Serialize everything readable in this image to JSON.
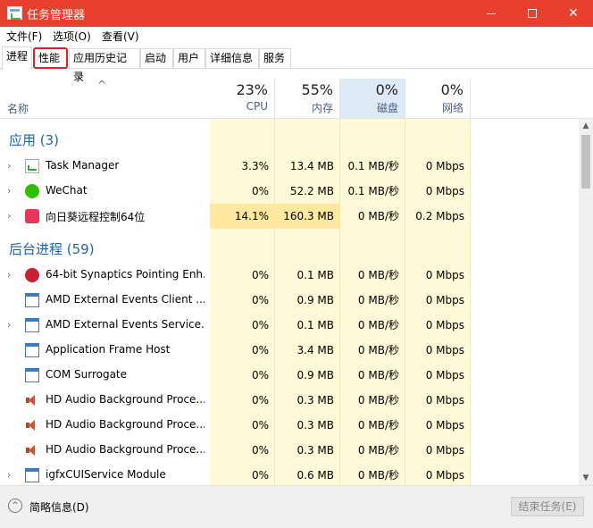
{
  "window": {
    "title": "任务管理器"
  },
  "menu": {
    "file": "文件(F)",
    "options": "选项(O)",
    "view": "查看(V)"
  },
  "tabs": [
    {
      "label": "进程"
    },
    {
      "label": "性能"
    },
    {
      "label": "应用历史记录"
    },
    {
      "label": "启动"
    },
    {
      "label": "用户"
    },
    {
      "label": "详细信息"
    },
    {
      "label": "服务"
    }
  ],
  "header": {
    "name_label": "名称",
    "cpu": {
      "pct": "23%",
      "label": "CPU"
    },
    "memory": {
      "pct": "55%",
      "label": "内存"
    },
    "disk": {
      "pct": "0%",
      "label": "磁盘"
    },
    "network": {
      "pct": "0%",
      "label": "网络"
    }
  },
  "groups": {
    "apps": "应用 (3)",
    "background": "后台进程 (59)"
  },
  "apps": [
    {
      "name": "Task Manager",
      "cpu": "3.3%",
      "mem": "13.4 MB",
      "disk": "0.1 MB/秒",
      "net": "0 Mbps",
      "icon": "task-manager-icon"
    },
    {
      "name": "WeChat",
      "cpu": "0%",
      "mem": "52.2 MB",
      "disk": "0.1 MB/秒",
      "net": "0 Mbps",
      "icon": "wechat-icon"
    },
    {
      "name": "向日葵远程控制64位",
      "cpu": "14.1%",
      "mem": "160.3 MB",
      "disk": "0 MB/秒",
      "net": "0.2 Mbps",
      "icon": "sunlogin-icon"
    }
  ],
  "background": [
    {
      "name": "64-bit Synaptics Pointing Enh...",
      "cpu": "0%",
      "mem": "0.1 MB",
      "disk": "0 MB/秒",
      "net": "0 Mbps",
      "icon": "synaptics-icon"
    },
    {
      "name": "AMD External Events Client ...",
      "cpu": "0%",
      "mem": "0.9 MB",
      "disk": "0 MB/秒",
      "net": "0 Mbps",
      "icon": "window-icon"
    },
    {
      "name": "AMD External Events Service...",
      "cpu": "0%",
      "mem": "0.1 MB",
      "disk": "0 MB/秒",
      "net": "0 Mbps",
      "icon": "window-icon"
    },
    {
      "name": "Application Frame Host",
      "cpu": "0%",
      "mem": "3.4 MB",
      "disk": "0 MB/秒",
      "net": "0 Mbps",
      "icon": "window-icon"
    },
    {
      "name": "COM Surrogate",
      "cpu": "0%",
      "mem": "0.9 MB",
      "disk": "0 MB/秒",
      "net": "0 Mbps",
      "icon": "window-icon"
    },
    {
      "name": "HD Audio Background Proce...",
      "cpu": "0%",
      "mem": "0.3 MB",
      "disk": "0 MB/秒",
      "net": "0 Mbps",
      "icon": "speaker-icon"
    },
    {
      "name": "HD Audio Background Proce...",
      "cpu": "0%",
      "mem": "0.3 MB",
      "disk": "0 MB/秒",
      "net": "0 Mbps",
      "icon": "speaker-icon"
    },
    {
      "name": "HD Audio Background Proce...",
      "cpu": "0%",
      "mem": "0.3 MB",
      "disk": "0 MB/秒",
      "net": "0 Mbps",
      "icon": "speaker-icon"
    },
    {
      "name": "igfxCUIService Module",
      "cpu": "0%",
      "mem": "0.6 MB",
      "disk": "0 MB/秒",
      "net": "0 Mbps",
      "icon": "window-icon"
    }
  ],
  "footer": {
    "fewer_details": "简略信息(D)",
    "end_task": "结束任务(E)"
  },
  "colors": {
    "titlebar": "#e8402f",
    "heat_light": "#fff9d9",
    "heat_strong": "#ffe9a0",
    "group_text": "#1e63b8",
    "annotation": "#e02020"
  }
}
